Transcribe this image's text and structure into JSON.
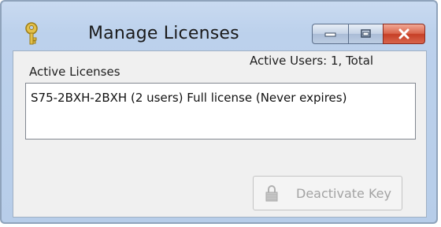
{
  "window": {
    "title": "Manage Licenses",
    "controls": {
      "minimize": "minimize-icon",
      "maximize": "maximize-icon",
      "close": "close-icon"
    }
  },
  "app_icon": "key-icon",
  "labels": {
    "active_licenses": "Active Licenses",
    "active_users": "Active Users: 1,  Total"
  },
  "licenses": [
    {
      "text": "S75-2BXH-2BXH (2 users) Full license (Never expires)"
    }
  ],
  "buttons": {
    "deactivate_key": "Deactivate Key",
    "deactivate_enabled": false,
    "deactivate_icon": "lock-icon"
  },
  "colors": {
    "close_button": "#c63f26",
    "title_bar": "#bcd1ec",
    "disabled_text": "#a3a3a3"
  }
}
